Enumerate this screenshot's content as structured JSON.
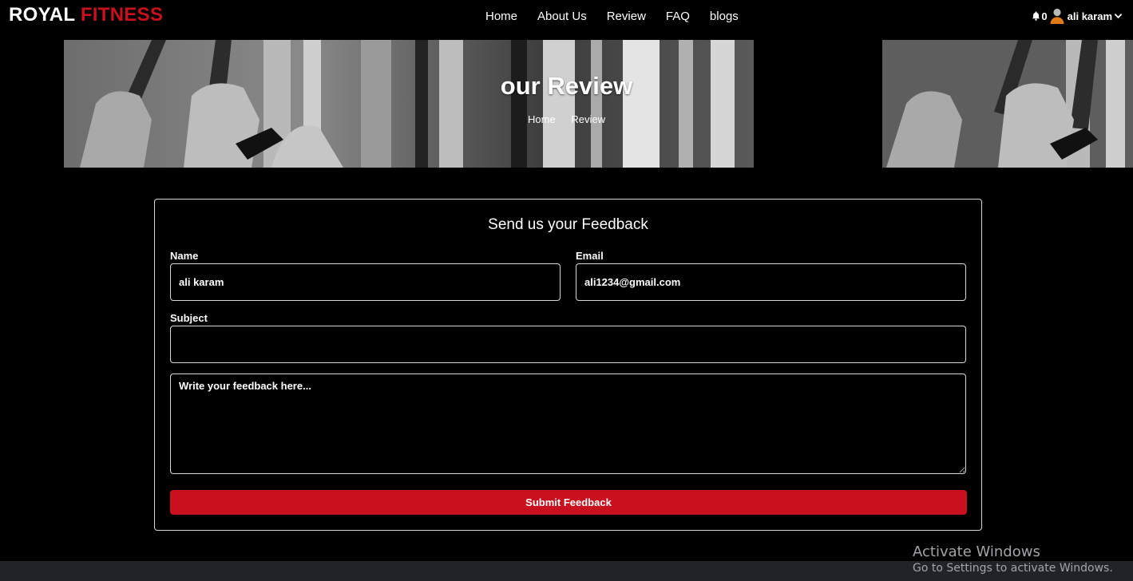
{
  "brand": {
    "part1": "ROYAL",
    "part2": "FITNESS"
  },
  "nav": [
    {
      "label": "Home"
    },
    {
      "label": "About Us"
    },
    {
      "label": "Review"
    },
    {
      "label": "FAQ"
    },
    {
      "label": "blogs"
    }
  ],
  "user": {
    "notification_count": "0",
    "name": "ali karam"
  },
  "hero": {
    "title": "our Review",
    "breadcrumbs": [
      "Home",
      "Review"
    ]
  },
  "form": {
    "title": "Send us your Feedback",
    "name_label": "Name",
    "name_value": "ali karam",
    "email_label": "Email",
    "email_value": "ali1234@gmail.com",
    "subject_label": "Subject",
    "subject_value": "",
    "feedback_placeholder": "Write your feedback here...",
    "submit_label": "Submit Feedback"
  },
  "watermark": {
    "line1": "Activate Windows",
    "line2": "Go to Settings to activate Windows."
  },
  "colors": {
    "accent": "#c8101f",
    "background": "#000000",
    "footer": "#202328"
  }
}
